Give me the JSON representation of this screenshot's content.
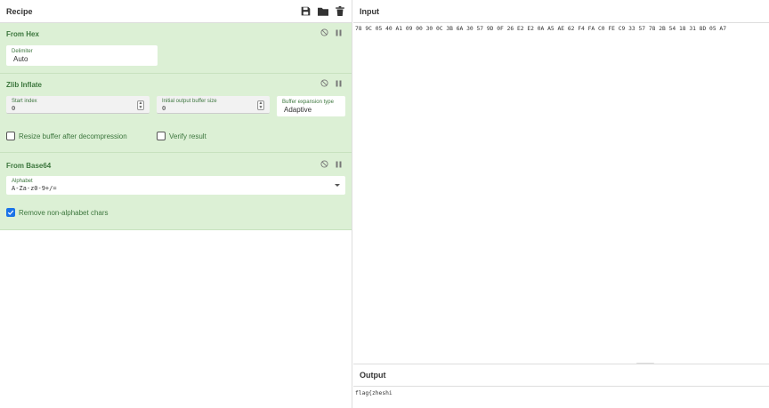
{
  "recipe": {
    "title": "Recipe",
    "header_icons": [
      "save-icon",
      "folder-icon",
      "trash-icon"
    ],
    "operations": [
      {
        "name": "From Hex",
        "fields": [
          {
            "label": "Delimiter",
            "value": "Auto"
          }
        ]
      },
      {
        "name": "Zlib Inflate",
        "fields": [
          {
            "label": "Start index",
            "value": "0"
          },
          {
            "label": "Initial output buffer size",
            "value": "0"
          },
          {
            "label": "Buffer expansion type",
            "value": "Adaptive"
          }
        ],
        "checkboxes": [
          {
            "label": "Resize buffer after decompression",
            "checked": false
          },
          {
            "label": "Verify result",
            "checked": false
          }
        ]
      },
      {
        "name": "From Base64",
        "fields": [
          {
            "label": "Alphabet",
            "value": "A-Za-z0-9+/="
          }
        ],
        "checkboxes": [
          {
            "label": "Remove non-alphabet chars",
            "checked": true
          }
        ]
      }
    ]
  },
  "input": {
    "title": "Input",
    "text": "78 9C 05 40 A1 09 00 30 0C 3B 6A 30 57 9D 0F 26 E2 E2 0A A5 AE 62 F4 FA C0 FE C9 33 57 78 2B 54 18 31 8D 05 A7"
  },
  "output": {
    "title": "Output",
    "text": "flag{zheshi"
  },
  "colors": {
    "operation_bg": "#dcf0d5",
    "operation_text": "#3c763d",
    "checkbox_checked": "#1a73e8"
  }
}
